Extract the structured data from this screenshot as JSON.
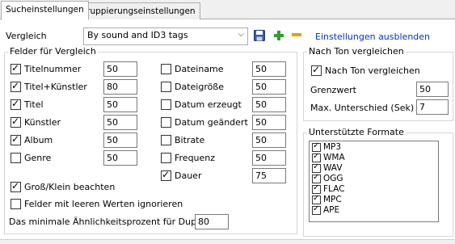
{
  "tabs": [
    {
      "label": "Sucheinstellungen",
      "active": true
    },
    {
      "label": "Gruppierungseinstellungen",
      "active": false
    }
  ],
  "compare": {
    "label": "Vergleich",
    "value": "By sound and ID3 tags",
    "hide_link": "Einstellungen ausblenden"
  },
  "fields_group": {
    "title": "Felder für Vergleich",
    "left": [
      {
        "label": "Titelnummer",
        "checked": true,
        "value": "50"
      },
      {
        "label": "Titel+Künstler",
        "checked": true,
        "value": "80"
      },
      {
        "label": "Titel",
        "checked": true,
        "value": "50"
      },
      {
        "label": "Künstler",
        "checked": true,
        "value": "50"
      },
      {
        "label": "Album",
        "checked": true,
        "value": "50"
      },
      {
        "label": "Genre",
        "checked": false,
        "value": "50"
      }
    ],
    "right": [
      {
        "label": "Dateiname",
        "checked": false,
        "value": "50"
      },
      {
        "label": "Dateigröße",
        "checked": false,
        "value": "50"
      },
      {
        "label": "Datum erzeugt",
        "checked": false,
        "value": "50"
      },
      {
        "label": "Datum geändert",
        "checked": false,
        "value": "50"
      },
      {
        "label": "Bitrate",
        "checked": false,
        "value": "50"
      },
      {
        "label": "Frequenz",
        "checked": false,
        "value": "50"
      },
      {
        "label": "Dauer",
        "checked": true,
        "value": "75"
      }
    ],
    "case_sensitive": {
      "label": "Groß/Klein beachten",
      "checked": true
    },
    "ignore_empty": {
      "label": "Felder mit leeren Werten ignorieren",
      "checked": false
    },
    "min_similarity": {
      "label": "Das minimale Ähnlichkeitsprozent für Duplikate",
      "value": "80"
    }
  },
  "sound_group": {
    "title": "Nach Ton vergleichen",
    "compare_by_sound": {
      "label": "Nach Ton vergleichen",
      "checked": true
    },
    "threshold": {
      "label": "Grenzwert",
      "value": "50"
    },
    "max_diff": {
      "label": "Max. Unterschied (Sek)",
      "value": "7"
    }
  },
  "formats_group": {
    "title": "Unterstützte Formate",
    "items": [
      {
        "label": "MP3",
        "checked": true
      },
      {
        "label": "WMA",
        "checked": true
      },
      {
        "label": "WAV",
        "checked": true
      },
      {
        "label": "OGG",
        "checked": true
      },
      {
        "label": "FLAC",
        "checked": true
      },
      {
        "label": "MPC",
        "checked": true
      },
      {
        "label": "APE",
        "checked": true
      }
    ]
  },
  "colors": {
    "accent_link": "#0033cc",
    "save_icon": "#3b5a9a",
    "add_icon": "#2e9e2e",
    "remove_icon": "#e0a400"
  }
}
